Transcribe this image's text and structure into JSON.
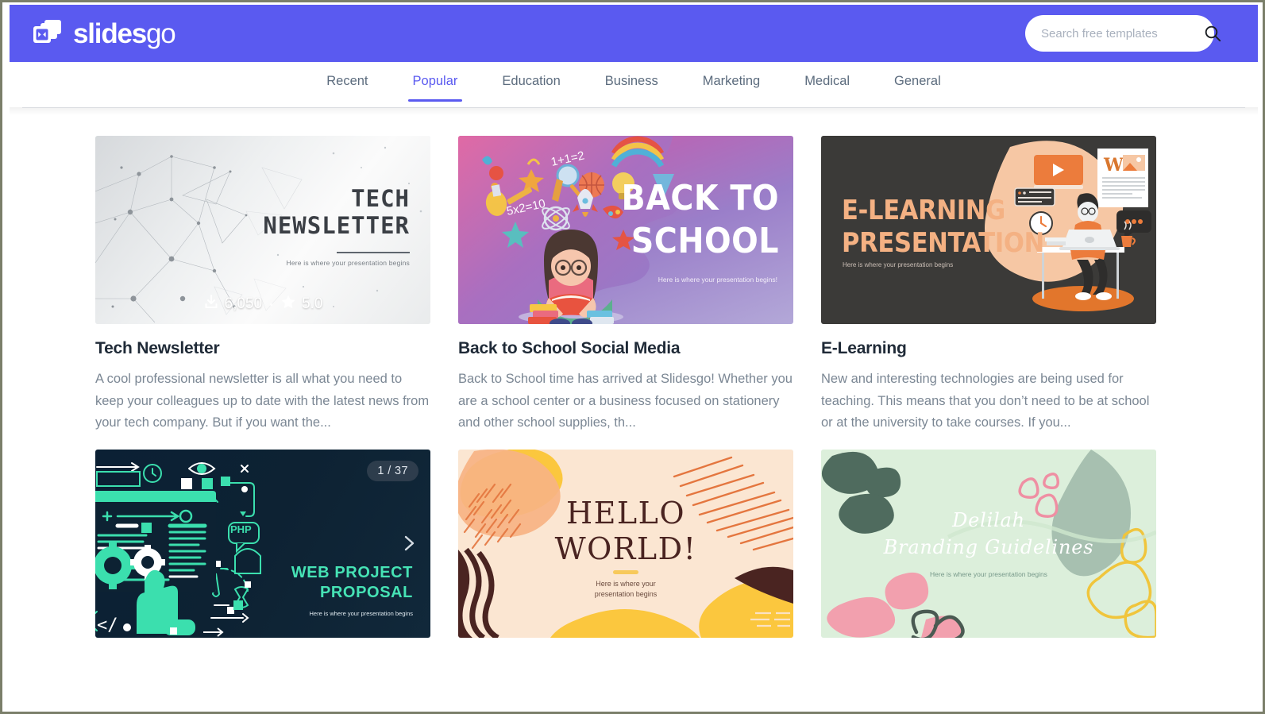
{
  "brand": {
    "name_bold": "slides",
    "name_light": "go",
    "logo_icon": "slides-stack-icon"
  },
  "search": {
    "placeholder": "Search free templates",
    "value": "",
    "icon": "search-icon"
  },
  "nav": {
    "tabs": [
      {
        "label": "Recent",
        "active": false
      },
      {
        "label": "Popular",
        "active": true
      },
      {
        "label": "Education",
        "active": false
      },
      {
        "label": "Business",
        "active": false
      },
      {
        "label": "Marketing",
        "active": false
      },
      {
        "label": "Medical",
        "active": false
      },
      {
        "label": "General",
        "active": false
      }
    ]
  },
  "colors": {
    "header_purple": "#5a5af0",
    "tab_active": "#5a5af0",
    "tab_inactive": "#5b6b7d",
    "title": "#1f2a37",
    "description": "#7b8794",
    "frame_border": "#7b7f6a"
  },
  "cards": [
    {
      "title": "Tech Newsletter",
      "description": "A cool professional newsletter is all what you need to keep your colleagues up to date with the latest news from your tech company. But if you want the...",
      "stats": {
        "downloads": "6,050",
        "downloads_icon": "download-icon",
        "rating": "5.0",
        "rating_icon": "star-icon"
      },
      "thumb": {
        "heading": "TECH\nNEWSLETTER",
        "subtitle": "Here is where your presentation begins"
      }
    },
    {
      "title": "Back to School Social Media",
      "description": "Back to School time has arrived at Slidesgo! Whether you are a school center or a business focused on stationery and other school supplies, th...",
      "thumb": {
        "heading": "BACK TO\nSCHOOL",
        "subtitle": "Here is where your presentation begins!"
      }
    },
    {
      "title": "E-Learning",
      "description": "New and interesting technologies are being used for teaching. This means that you don’t need to be at school or at the university to take courses. If you...",
      "thumb": {
        "heading": "E-LEARNING\nPRESENTATION",
        "subtitle": "Here is where your presentation begins"
      }
    },
    {
      "title": "",
      "description": "",
      "counter": "1 / 37",
      "next_icon": "chevron-right-icon",
      "thumb": {
        "heading": "WEB PROJECT\nPROPOSAL",
        "subtitle": "Here is where your presentation begins",
        "badge": "PHP",
        "code_glyph": "</"
      }
    },
    {
      "title": "",
      "description": "",
      "thumb": {
        "heading": "HELLO\nWORLD!",
        "subtitle": "Here is where your\npresentation begins"
      }
    },
    {
      "title": "",
      "description": "",
      "thumb": {
        "heading": "Delilah\nBranding Guidelines",
        "subtitle": "Here is where your presentation begins"
      }
    }
  ]
}
